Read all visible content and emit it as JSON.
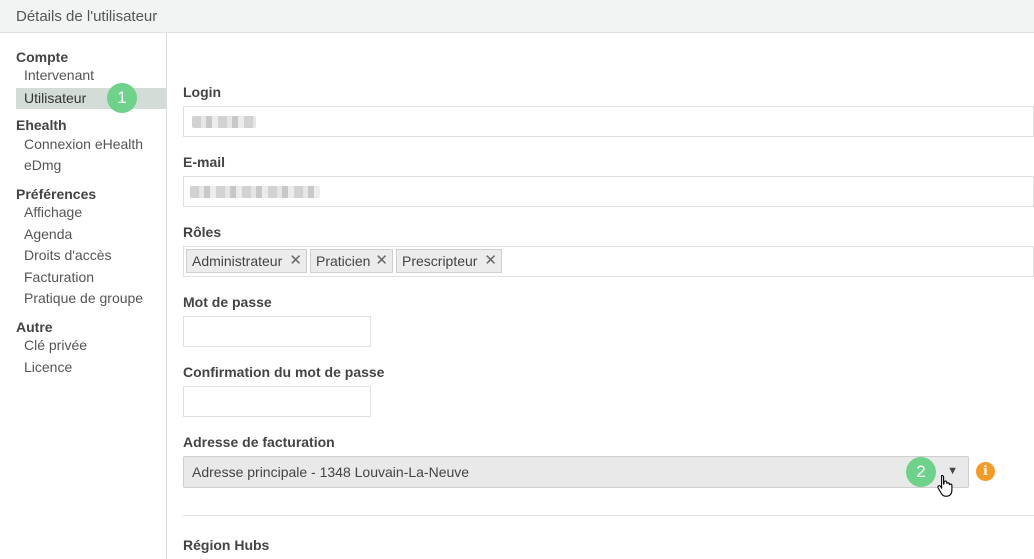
{
  "window": {
    "title": "Détails de l'utilisateur"
  },
  "sidebar": {
    "sections": [
      {
        "heading": "Compte",
        "items": [
          "Intervenant",
          "Utilisateur"
        ]
      },
      {
        "heading": "Ehealth",
        "items": [
          "Connexion eHealth",
          "eDmg"
        ]
      },
      {
        "heading": "Préférences",
        "items": [
          "Affichage",
          "Agenda",
          "Droits d'accès",
          "Facturation",
          "Pratique de groupe"
        ]
      },
      {
        "heading": "Autre",
        "items": [
          "Clé privée",
          "Licence"
        ]
      }
    ],
    "active_item": "Utilisateur"
  },
  "badges": {
    "first": "1",
    "second": "2"
  },
  "form": {
    "login_label": "Login",
    "email_label": "E-mail",
    "roles_label": "Rôles",
    "roles": [
      "Administrateur",
      "Praticien",
      "Prescripteur"
    ],
    "remove_glyph": "✕",
    "password_label": "Mot de passe",
    "password_confirm_label": "Confirmation du mot de passe",
    "billing_address_label": "Adresse de facturation",
    "billing_address_value": "Adresse principale - 1348 Louvain-La-Neuve",
    "info_glyph": "i",
    "region_hubs_label": "Région Hubs"
  },
  "colors": {
    "badge": "#6fd28a",
    "active_bg": "#d3dcd6",
    "info": "#f59a23"
  },
  "icons": [
    "close-icon",
    "caret-down-icon",
    "info-icon",
    "hand-cursor-icon"
  ]
}
